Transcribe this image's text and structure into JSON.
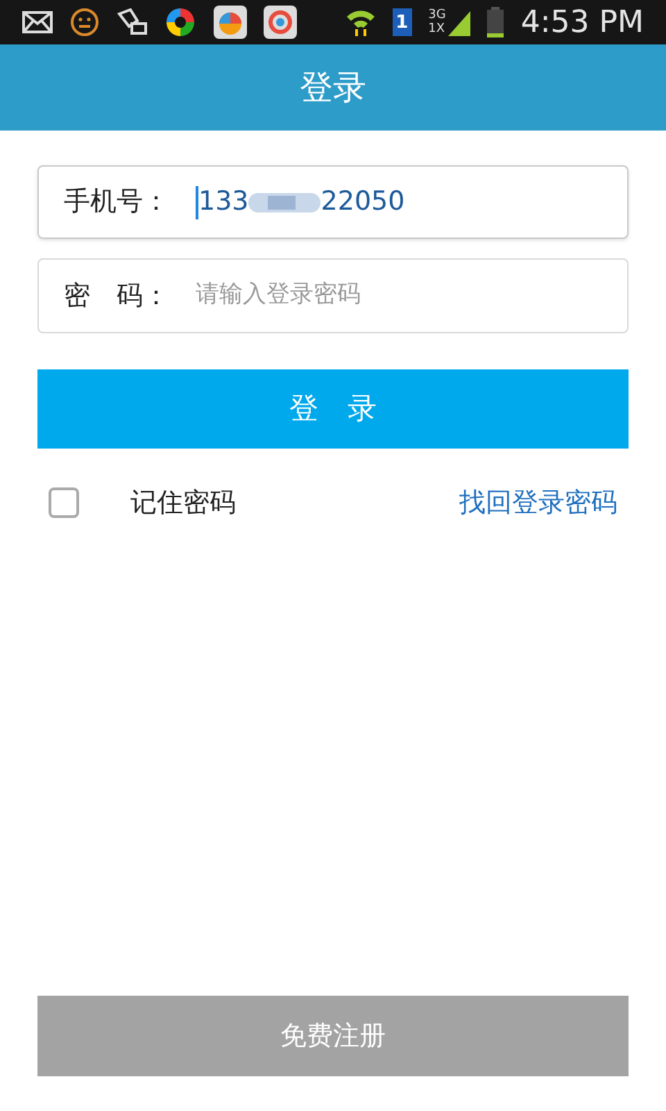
{
  "status_bar": {
    "sim_slot": "1",
    "network_top": "3G",
    "network_bottom": "1X",
    "time": "4:53 PM"
  },
  "header": {
    "title": "登录"
  },
  "form": {
    "phone": {
      "label": "手机号：",
      "value_start": "133",
      "value_end": "22050",
      "focused": true
    },
    "password": {
      "label": "密　码：",
      "placeholder": "请输入登录密码"
    },
    "login_button": "登　录",
    "remember": {
      "label": "记住密码",
      "checked": false
    },
    "forgot_link": "找回登录密码"
  },
  "register_button": {
    "label": "免费注册",
    "disabled": true
  }
}
